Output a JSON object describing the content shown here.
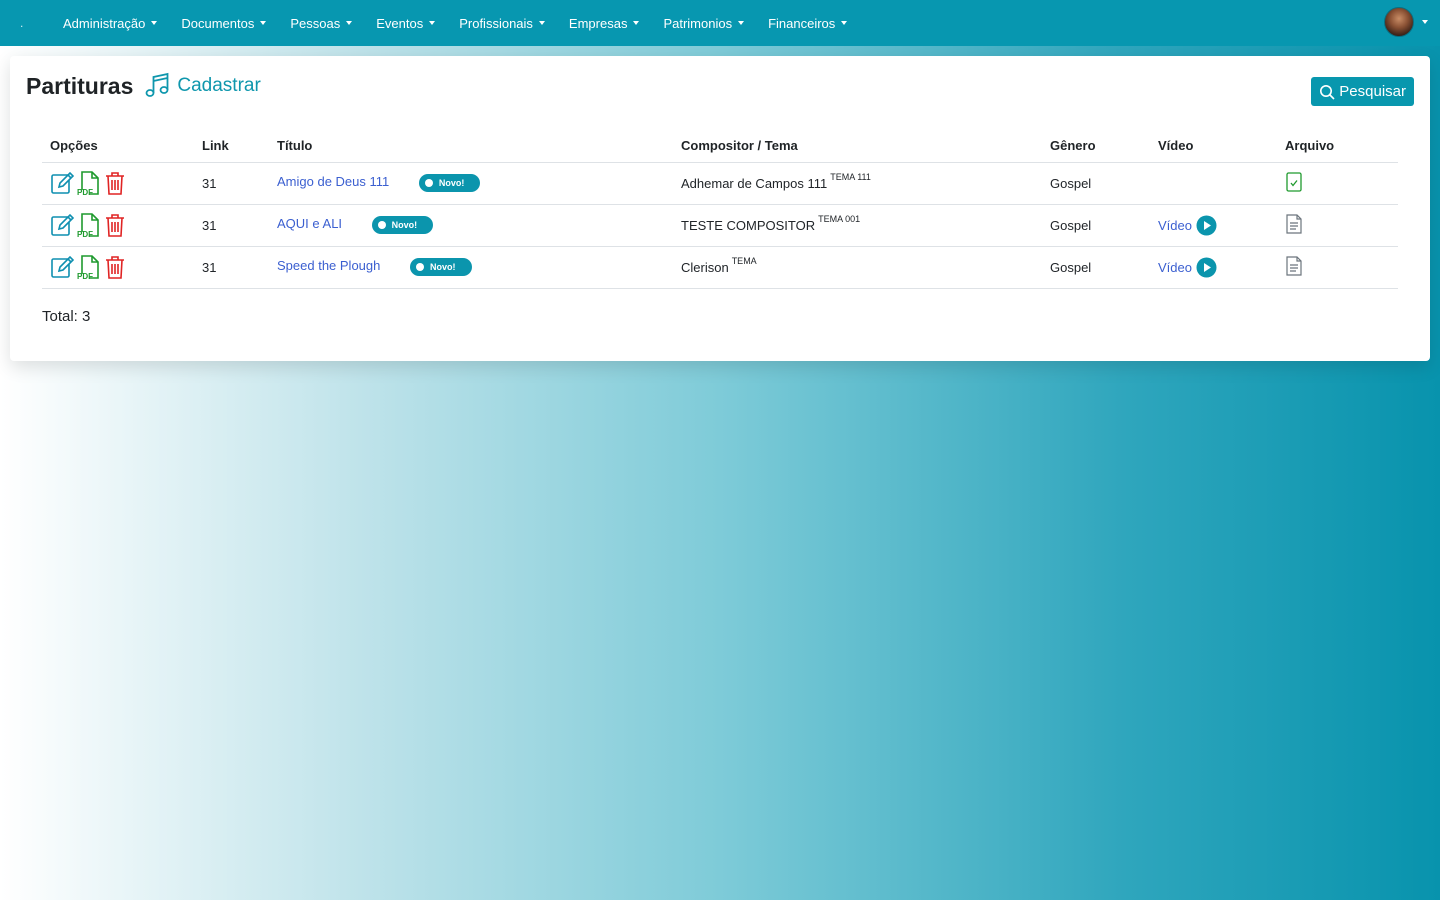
{
  "nav": {
    "brand": ".",
    "items": [
      "Administração",
      "Documentos",
      "Pessoas",
      "Eventos",
      "Profissionais",
      "Empresas",
      "Patrimonios",
      "Financeiros"
    ]
  },
  "page": {
    "title": "Partituras",
    "add_label": "Cadastrar",
    "search_label": "Pesquisar"
  },
  "table": {
    "headers": {
      "options": "Opções",
      "link": "Link",
      "title": "Título",
      "composer": "Compositor / Tema",
      "genre": "Gênero",
      "video": "Vídeo",
      "file": "Arquivo"
    },
    "rows": [
      {
        "link": "31",
        "title": "Amigo de Deus 111",
        "badge": "Novo!",
        "composer": "Adhemar de Campos 111",
        "theme": "TEMA 111",
        "genre": "Gospel",
        "video": "",
        "file_status": "checked"
      },
      {
        "link": "31",
        "title": "AQUI e ALI",
        "badge": "Novo!",
        "composer": "TESTE COMPOSITOR",
        "theme": "TEMA 001",
        "genre": "Gospel",
        "video": "Vídeo",
        "file_status": "document"
      },
      {
        "link": "31",
        "title": "Speed the Plough",
        "badge": "Novo!",
        "composer": "Clerison",
        "theme": "TEMA",
        "genre": "Gospel",
        "video": "Vídeo",
        "file_status": "document"
      }
    ]
  },
  "total_label": "Total: 3",
  "colors": {
    "navbar": "#0797b0",
    "accent": "#0897ae",
    "link": "#3b5fd0",
    "edit_icon": "#0f8fb0",
    "pdf_icon": "#1f9a2e",
    "delete_icon": "#e02424"
  }
}
